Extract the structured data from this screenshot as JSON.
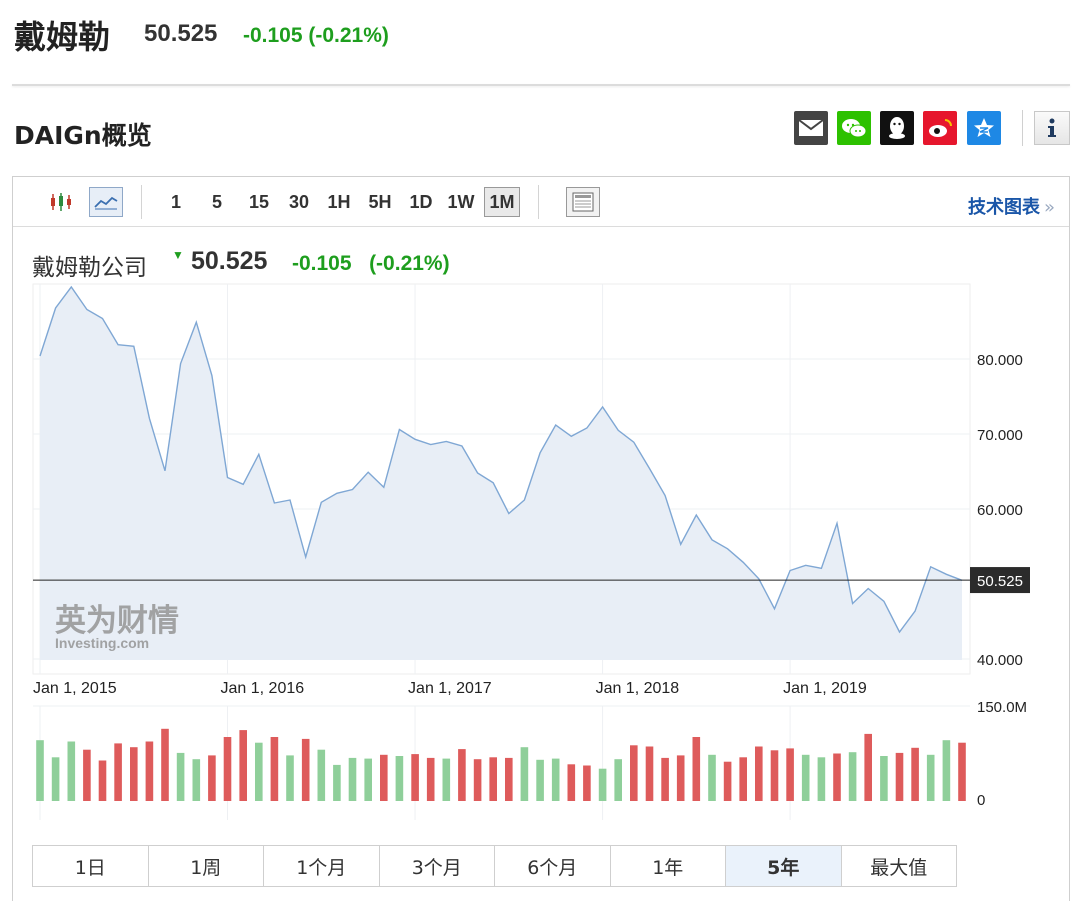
{
  "header": {
    "name": "戴姆勒",
    "price": "50.525",
    "change": "-0.105 (-0.21%)"
  },
  "section_title": "DAIGn概览",
  "share_icons": [
    "mail-icon",
    "wechat-icon",
    "qq-icon",
    "weibo-icon",
    "qzone-icon",
    "info-icon"
  ],
  "toolbar": {
    "intervals": [
      "1",
      "5",
      "15",
      "30",
      "1H",
      "5H",
      "1D",
      "1W",
      "1M"
    ],
    "active_interval": "1M",
    "tech_chart": "技术图表",
    "tech_chart_arrow": "»"
  },
  "quote": {
    "name": "戴姆勒公司",
    "price": "50.525",
    "change": "-0.105",
    "change_pct": "(-0.21%)"
  },
  "chart_data": {
    "type": "area",
    "ylim": [
      38,
      90
    ],
    "yticks": [
      "40.000",
      "60.000",
      "70.000",
      "80.000"
    ],
    "ytick_values": [
      40,
      60,
      70,
      80
    ],
    "current_value": 50.525,
    "current_label": "50.525",
    "x_labels": [
      "Jan 1, 2015",
      "Jan 1, 2016",
      "Jan 1, 2017",
      "Jan 1, 2018",
      "Jan 1, 2019"
    ],
    "x_label_index": [
      0,
      12,
      24,
      36,
      48
    ],
    "watermark": [
      "英为财情",
      "Investing.com"
    ],
    "series": [
      {
        "values": [
          80.4,
          86.8,
          89.6,
          86.6,
          85.4,
          81.9,
          81.7,
          72.1,
          65.1,
          79.4,
          84.9,
          77.8,
          64.2,
          63.3,
          67.3,
          60.8,
          61.2,
          53.6,
          60.9,
          62.1,
          62.6,
          64.9,
          62.9,
          70.6,
          69.3,
          68.6,
          69.0,
          68.4,
          64.8,
          63.5,
          59.4,
          61.2,
          67.5,
          71.2,
          69.7,
          70.8,
          73.6,
          70.5,
          68.9,
          65.4,
          61.8,
          55.3,
          59.2,
          55.9,
          54.7,
          52.9,
          50.7,
          46.7,
          51.8,
          52.5,
          52.1,
          58.1,
          47.4,
          49.4,
          47.7,
          43.6,
          46.4,
          52.3,
          51.3,
          50.5
        ]
      }
    ],
    "volume": {
      "ylim": [
        0,
        150000000
      ],
      "ytick_labels": [
        "150.0M",
        "0"
      ],
      "values": [
        96,
        69,
        94,
        81,
        64,
        91,
        85,
        94,
        114,
        76,
        66,
        72,
        101,
        112,
        92,
        101,
        72,
        98,
        81,
        57,
        68,
        67,
        73,
        71,
        74,
        68,
        67,
        82,
        66,
        69,
        68,
        85,
        65,
        67,
        58,
        56,
        51,
        66,
        88,
        86,
        68,
        72,
        101,
        73,
        62,
        69,
        86,
        80,
        83,
        73,
        69,
        75,
        77,
        106,
        71,
        76,
        84,
        73,
        96,
        92
      ],
      "directions": [
        "up",
        "up",
        "up",
        "down",
        "down",
        "down",
        "down",
        "down",
        "down",
        "up",
        "up",
        "down",
        "down",
        "down",
        "up",
        "down",
        "up",
        "down",
        "up",
        "up",
        "up",
        "up",
        "down",
        "up",
        "down",
        "down",
        "up",
        "down",
        "down",
        "down",
        "down",
        "up",
        "up",
        "up",
        "down",
        "down",
        "up",
        "up",
        "down",
        "down",
        "down",
        "down",
        "down",
        "up",
        "down",
        "down",
        "down",
        "down",
        "down",
        "up",
        "up",
        "down",
        "up",
        "down",
        "up",
        "down",
        "down",
        "up",
        "up",
        "down"
      ],
      "up_color": "#8fcf9a",
      "down_color": "#de5b5b"
    },
    "line_color": "#7fa7d4",
    "fill_color": "#e8eef6"
  },
  "ranges": {
    "items": [
      "1日",
      "1周",
      "1个月",
      "3个月",
      "6个月",
      "1年",
      "5年",
      "最大值"
    ],
    "active": "5年"
  }
}
